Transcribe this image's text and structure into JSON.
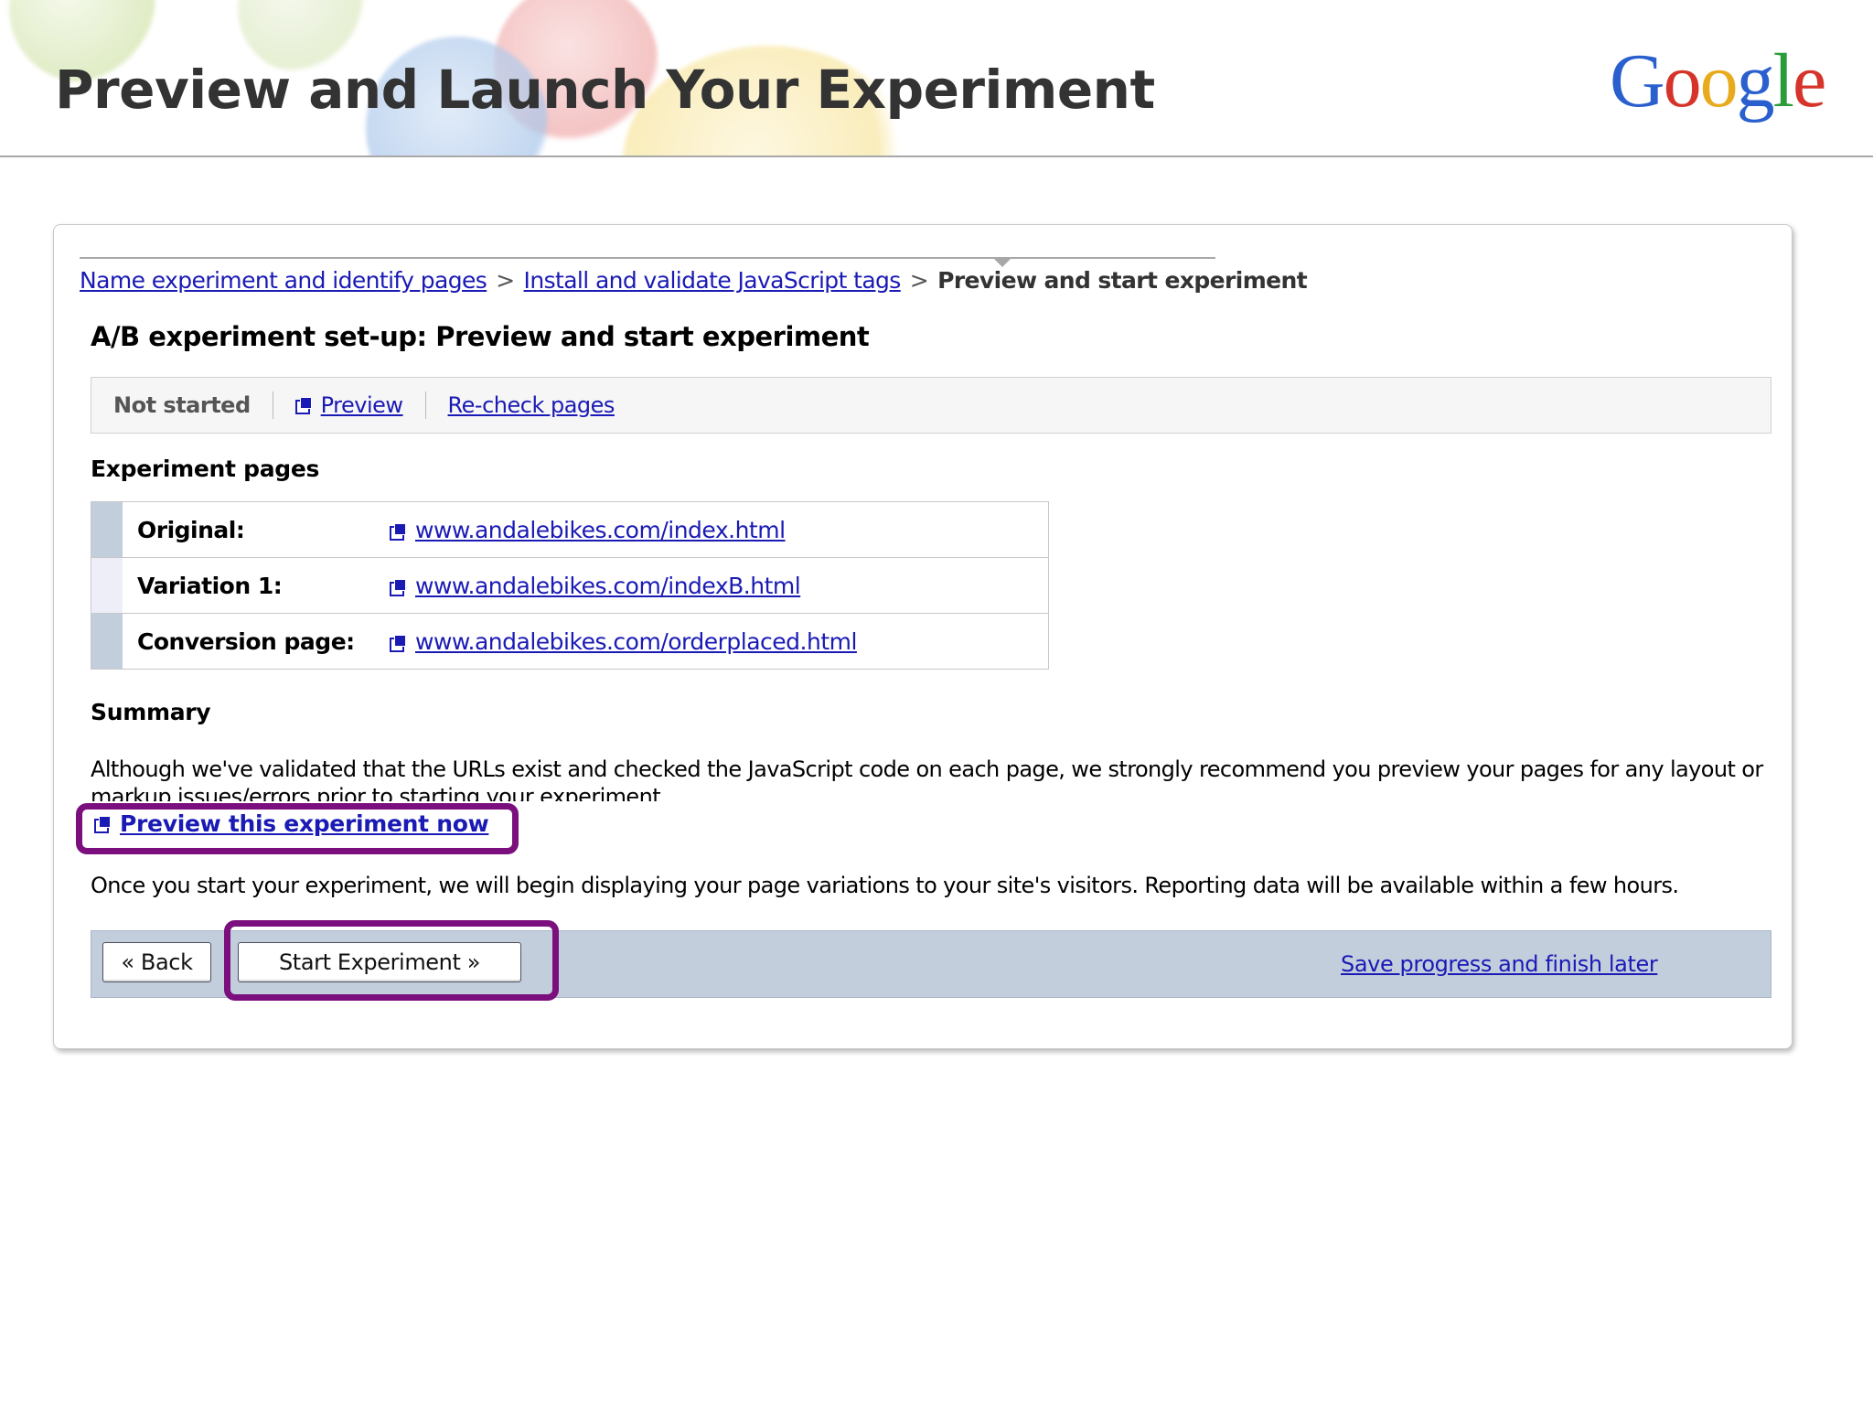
{
  "slide": {
    "title": "Preview and Launch Your Experiment",
    "logo": {
      "letters": [
        "G",
        "o",
        "o",
        "g",
        "l",
        "e"
      ]
    }
  },
  "wizard": {
    "breadcrumb": {
      "step1": "Name experiment and identify pages",
      "step2": "Install and validate JavaScript tags",
      "step3": "Preview and start experiment",
      "separator": ">"
    },
    "heading": "A/B experiment set-up: Preview and start experiment",
    "status_bar": {
      "status": "Not started",
      "preview_label": "Preview",
      "recheck_label": "Re-check pages"
    },
    "experiment_pages": {
      "heading": "Experiment pages",
      "rows": [
        {
          "label": "Original:",
          "url": "www.andalebikes.com/index.html",
          "swatch": "#c3cedd"
        },
        {
          "label": "Variation 1:",
          "url": "www.andalebikes.com/indexB.html",
          "swatch": "#eeeef9"
        },
        {
          "label": "Conversion page:",
          "url": "www.andalebikes.com/orderplaced.html",
          "swatch": "#c3cedd"
        }
      ]
    },
    "summary": {
      "heading": "Summary",
      "text": "Although we've validated that the URLs exist and checked the JavaScript code on each page, we strongly recommend you preview your pages for any layout or markup issues/errors prior to starting your experiment.",
      "preview_now_label": "Preview this experiment now",
      "once_text": "Once you start your experiment, we will begin displaying your page variations to your site's visitors. Reporting data will be available within a few hours."
    },
    "actions": {
      "back_label": "« Back",
      "start_label": "Start Experiment »",
      "save_label": "Save progress and finish later"
    }
  },
  "colors": {
    "link": "#1a1ab5",
    "highlight": "#7b0f7d",
    "action_bar": "#c3cedd"
  }
}
